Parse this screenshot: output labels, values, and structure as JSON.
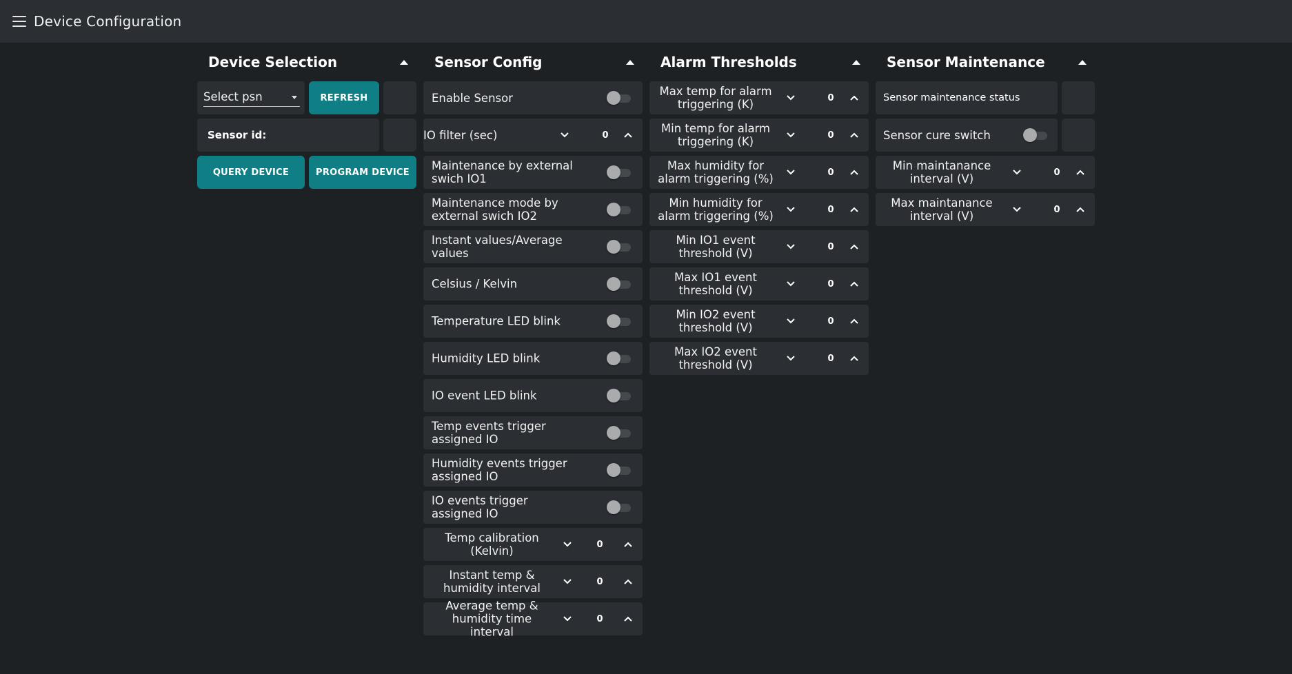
{
  "header": {
    "title": "Device Configuration",
    "menu_icon": "hamburger-menu-icon"
  },
  "device_selection": {
    "title": "Device Selection",
    "select_value": "Select psn",
    "refresh_label": "REFRESH",
    "sensor_id_label": "Sensor id:",
    "query_label": "QUERY DEVICE",
    "program_label": "PROGRAM DEVICE"
  },
  "sensor_config": {
    "title": "Sensor Config",
    "enable_sensor": "Enable Sensor",
    "io_filter": {
      "label": "IO filter (sec)",
      "value": "0"
    },
    "toggles": [
      "Maintenance by external swich IO1",
      "Maintenance mode by external swich IO2",
      "Instant values/Average values",
      "Celsius / Kelvin",
      "Temperature LED blink",
      "Humidity LED blink",
      "IO event LED blink",
      "Temp events trigger assigned IO",
      "Humidity events trigger assigned IO",
      "IO events trigger assigned IO"
    ],
    "steppers": [
      {
        "label": "Temp calibration (Kelvin)",
        "value": "0"
      },
      {
        "label": "Instant temp & humidity interval",
        "value": "0"
      },
      {
        "label": "Average temp & humidity time interval",
        "value": "0"
      }
    ]
  },
  "alarm_thresholds": {
    "title": "Alarm Thresholds",
    "items": [
      {
        "label": "Max temp for alarm triggering (K)",
        "value": "0"
      },
      {
        "label": "Min temp for alarm triggering (K)",
        "value": "0"
      },
      {
        "label": "Max humidity for alarm triggering (%)",
        "value": "0"
      },
      {
        "label": "Min humidity for alarm triggering (%)",
        "value": "0"
      },
      {
        "label": "Min IO1 event threshold (V)",
        "value": "0"
      },
      {
        "label": "Max IO1 event threshold (V)",
        "value": "0"
      },
      {
        "label": "Min IO2 event threshold (V)",
        "value": "0"
      },
      {
        "label": "Max IO2 event threshold (V)",
        "value": "0"
      }
    ]
  },
  "sensor_maintenance": {
    "title": "Sensor Maintenance",
    "status_label": "Sensor maintenance status",
    "cure_switch_label": "Sensor cure switch",
    "items": [
      {
        "label": "Min maintanance interval (V)",
        "value": "0"
      },
      {
        "label": "Max maintanance interval (V)",
        "value": "0"
      }
    ]
  }
}
